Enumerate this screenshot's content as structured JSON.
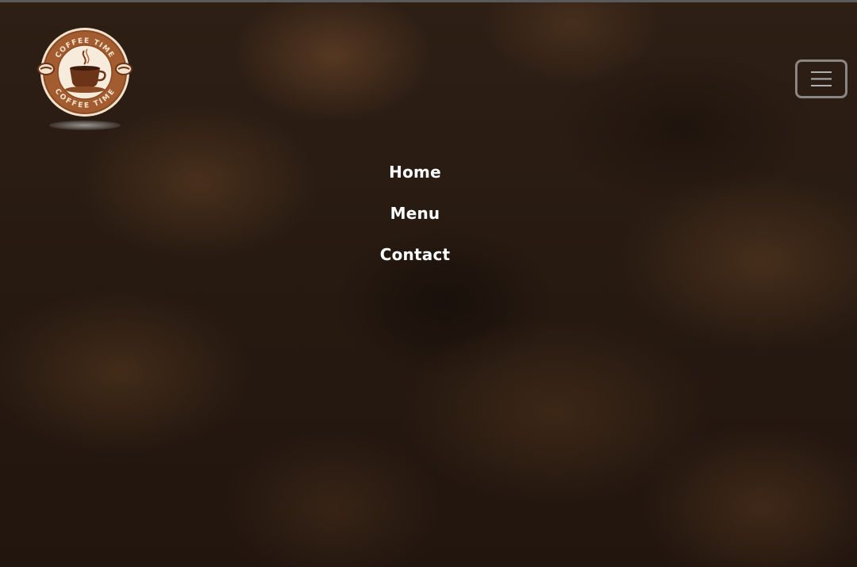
{
  "logo": {
    "text_top": "COFFEE TIME",
    "text_bottom": "COFFEE TIME",
    "icon": "coffee-cup-icon"
  },
  "menu_toggle": {
    "icon": "hamburger-menu-icon"
  },
  "nav": {
    "items": [
      {
        "label": "Home"
      },
      {
        "label": "Menu"
      },
      {
        "label": "Contact"
      }
    ]
  },
  "colors": {
    "logo_ring": "#8a4a24",
    "logo_cream": "#f3e3cc",
    "cup": "#6b3418",
    "nav_text": "#ffffff",
    "toggle_border": "#aaaaaa"
  }
}
